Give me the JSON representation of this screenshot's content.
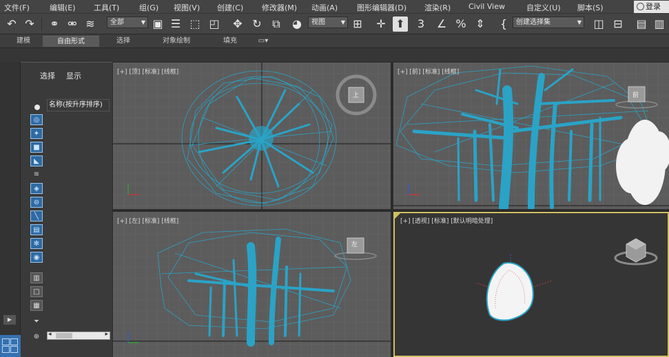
{
  "menu": {
    "items": [
      "文件(F)",
      "编辑(E)",
      "工具(T)",
      "组(G)",
      "视图(V)",
      "创建(C)",
      "修改器(M)",
      "动画(A)",
      "图形编辑器(D)",
      "渲染(R)",
      "Civil View",
      "自定义(U)",
      "脚本(S)"
    ],
    "login": "登录"
  },
  "toolbar": {
    "filter_value": "全部",
    "refcoord_value": "视图",
    "selection_set_value": "创建选择集",
    "percent_snap_text": "3"
  },
  "ribbon": {
    "tabs": [
      "建模",
      "自由形式",
      "选择",
      "对象绘制",
      "填充"
    ],
    "active": "自由形式"
  },
  "scene_explorer": {
    "tabs": [
      "选择",
      "显示"
    ],
    "column_header": "名称(按升序排序)"
  },
  "viewports": {
    "top": "[+] [顶] [标准] [线框]",
    "front": "[+] [前] [标准] [线框]",
    "left": "[+] [左] [标准] [线框]",
    "persp": "[+] [透视] [标准] [默认明暗处理]"
  },
  "viewcube": {
    "top_face": "上",
    "front_face": "前",
    "left_face": "左"
  },
  "colors": {
    "wire": "#2aa3c6",
    "bg": "#5c5c5c",
    "accent_active": "#d0c060"
  }
}
